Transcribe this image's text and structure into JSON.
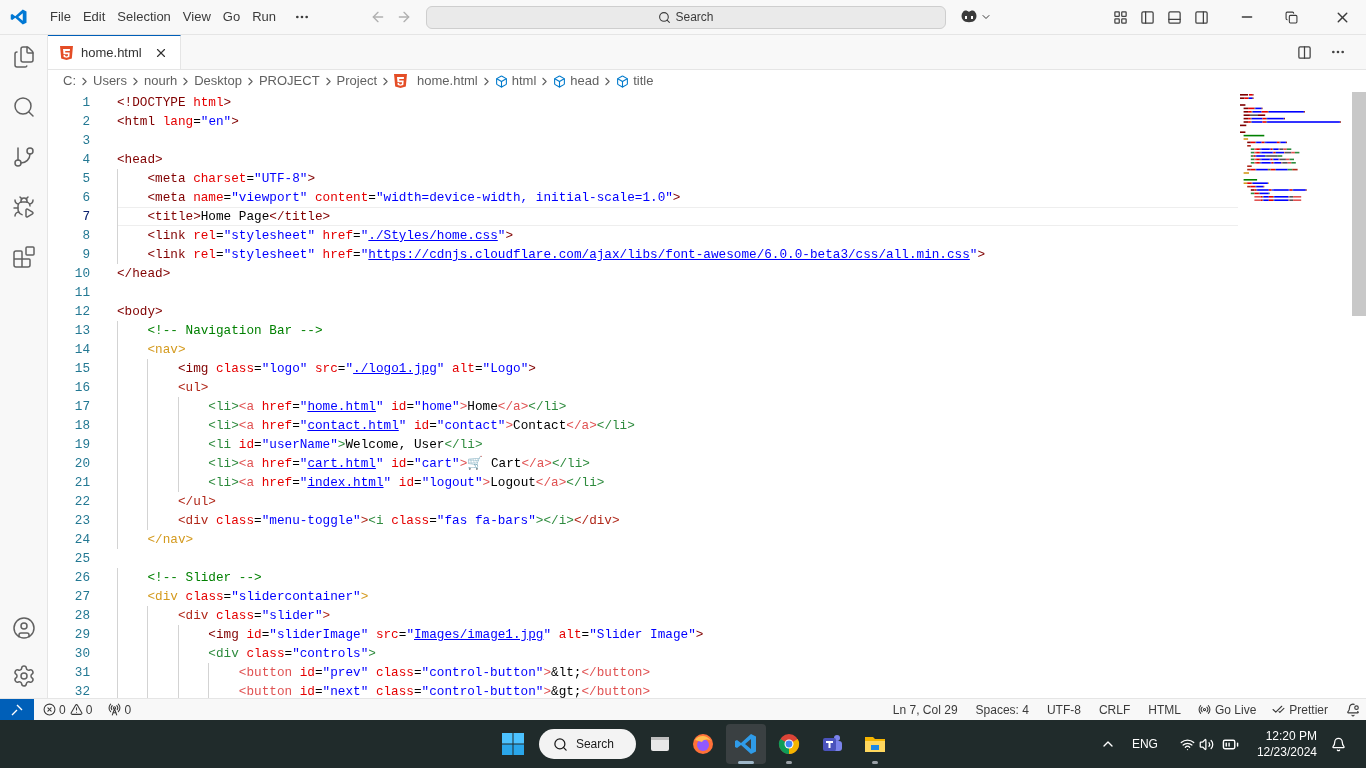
{
  "title_bar": {
    "menu": [
      "File",
      "Edit",
      "Selection",
      "View",
      "Go",
      "Run"
    ],
    "search": {
      "placeholder": "Search"
    }
  },
  "tab": {
    "label": "home.html",
    "selected": true
  },
  "breadcrumb": [
    {
      "label": "C:",
      "kind": "folder"
    },
    {
      "label": "Users",
      "kind": "folder"
    },
    {
      "label": "nourh",
      "kind": "folder"
    },
    {
      "label": "Desktop",
      "kind": "folder"
    },
    {
      "label": "PROJECT",
      "kind": "folder"
    },
    {
      "label": "Project",
      "kind": "folder"
    },
    {
      "label": "home.html",
      "kind": "file"
    },
    {
      "label": "html",
      "kind": "symbol"
    },
    {
      "label": "head",
      "kind": "symbol"
    },
    {
      "label": "title",
      "kind": "symbol"
    }
  ],
  "editor": {
    "lines": [
      {
        "number": "1",
        "current": false,
        "tokens": [
          {
            "text": "<!DOCTYPE ",
            "kind": "tag"
          },
          {
            "text": "html",
            "kind": "attr"
          },
          {
            "text": ">",
            "kind": "tag"
          }
        ]
      },
      {
        "number": "2",
        "current": false,
        "tokens": [
          {
            "text": "<html",
            "kind": "tag"
          },
          {
            "text": " lang",
            "kind": "attr"
          },
          {
            "text": "=",
            "kind": "punct"
          },
          {
            "text": "\"en\"",
            "kind": "str"
          },
          {
            "text": ">",
            "kind": "tag"
          }
        ]
      },
      {
        "number": "3",
        "current": false
      },
      {
        "number": "4",
        "current": false,
        "tokens": [
          {
            "text": "<head>",
            "kind": "tag"
          }
        ]
      },
      {
        "number": "5",
        "current": false,
        "tokens": [
          {
            "text": "    <meta",
            "kind": "tag"
          },
          {
            "text": " charset",
            "kind": "attr"
          },
          {
            "text": "=",
            "kind": "punct"
          },
          {
            "text": "\"UTF-8\"",
            "kind": "str"
          },
          {
            "text": ">",
            "kind": "tag"
          }
        ]
      },
      {
        "number": "6",
        "current": false,
        "tokens": [
          {
            "text": "    <meta",
            "kind": "tag"
          },
          {
            "text": " name",
            "kind": "attr"
          },
          {
            "text": "=",
            "kind": "punct"
          },
          {
            "text": "\"viewport\"",
            "kind": "str"
          },
          {
            "text": " content",
            "kind": "attr"
          },
          {
            "text": "=",
            "kind": "punct"
          },
          {
            "text": "\"width=device-width, initial-scale=1.0\"",
            "kind": "str"
          },
          {
            "text": ">",
            "kind": "tag"
          }
        ]
      },
      {
        "number": "7",
        "current": true,
        "tokens": [
          {
            "text": "    <title>",
            "kind": "tag"
          },
          {
            "text": "Home Page",
            "kind": "text"
          },
          {
            "text": "</title>",
            "kind": "tag"
          }
        ]
      },
      {
        "number": "8",
        "current": false,
        "tokens": [
          {
            "text": "    <link",
            "kind": "tag"
          },
          {
            "text": " rel",
            "kind": "attr"
          },
          {
            "text": "=",
            "kind": "punct"
          },
          {
            "text": "\"stylesheet\"",
            "kind": "str"
          },
          {
            "text": " href",
            "kind": "attr"
          },
          {
            "text": "=",
            "kind": "punct"
          },
          {
            "text": "\"",
            "kind": "str"
          },
          {
            "text": "./Styles/home.css",
            "kind": "link"
          },
          {
            "text": "\"",
            "kind": "str"
          },
          {
            "text": ">",
            "kind": "tag"
          }
        ]
      },
      {
        "number": "9",
        "current": false,
        "tokens": [
          {
            "text": "    <link",
            "kind": "tag"
          },
          {
            "text": " rel",
            "kind": "attr"
          },
          {
            "text": "=",
            "kind": "punct"
          },
          {
            "text": "\"stylesheet\"",
            "kind": "str"
          },
          {
            "text": " href",
            "kind": "attr"
          },
          {
            "text": "=",
            "kind": "punct"
          },
          {
            "text": "\"",
            "kind": "str"
          },
          {
            "text": "https://cdnjs.cloudflare.com/ajax/libs/font-awesome/6.0.0-beta3/css/all.min.css",
            "kind": "link"
          },
          {
            "text": "\"",
            "kind": "str"
          },
          {
            "text": ">",
            "kind": "tag"
          }
        ]
      },
      {
        "number": "10",
        "current": false,
        "tokens": [
          {
            "text": "</head>",
            "kind": "tag"
          }
        ]
      },
      {
        "number": "11",
        "current": false
      },
      {
        "number": "12",
        "current": false,
        "tokens": [
          {
            "text": "<body>",
            "kind": "tag"
          }
        ]
      },
      {
        "number": "13",
        "current": false,
        "tokens": [
          {
            "text": "    <!-- Navigation Bar -->",
            "kind": "comment"
          }
        ]
      },
      {
        "number": "14",
        "current": false,
        "tokens": [
          {
            "text": "    <nav>",
            "kind": "tag_outer"
          }
        ]
      },
      {
        "number": "15",
        "current": false,
        "tokens": [
          {
            "text": "        <img",
            "kind": "tag"
          },
          {
            "text": " class",
            "kind": "attr"
          },
          {
            "text": "=",
            "kind": "punct"
          },
          {
            "text": "\"logo\"",
            "kind": "str"
          },
          {
            "text": " src",
            "kind": "attr"
          },
          {
            "text": "=",
            "kind": "punct"
          },
          {
            "text": "\"",
            "kind": "str"
          },
          {
            "text": "./logo1.jpg",
            "kind": "link"
          },
          {
            "text": "\"",
            "kind": "str"
          },
          {
            "text": " alt",
            "kind": "attr"
          },
          {
            "text": "=",
            "kind": "punct"
          },
          {
            "text": "\"Logo\"",
            "kind": "str"
          },
          {
            "text": ">",
            "kind": "tag"
          }
        ]
      },
      {
        "number": "16",
        "current": false,
        "tokens": [
          {
            "text": "        <ul>",
            "kind": "tag_mid"
          }
        ]
      },
      {
        "number": "17",
        "current": false,
        "tokens": [
          {
            "text": "            <li>",
            "kind": "tag_inner"
          },
          {
            "text": "<a",
            "kind": "tag_deep"
          },
          {
            "text": " href",
            "kind": "attr"
          },
          {
            "text": "=",
            "kind": "punct"
          },
          {
            "text": "\"",
            "kind": "str"
          },
          {
            "text": "home.html",
            "kind": "link"
          },
          {
            "text": "\"",
            "kind": "str"
          },
          {
            "text": " id",
            "kind": "attr"
          },
          {
            "text": "=",
            "kind": "punct"
          },
          {
            "text": "\"home\"",
            "kind": "str"
          },
          {
            "text": ">",
            "kind": "tag_deep"
          },
          {
            "text": "Home",
            "kind": "text"
          },
          {
            "text": "</a>",
            "kind": "tag_deep"
          },
          {
            "text": "</li>",
            "kind": "tag_inner"
          }
        ]
      },
      {
        "number": "18",
        "current": false,
        "tokens": [
          {
            "text": "            <li>",
            "kind": "tag_inner"
          },
          {
            "text": "<a",
            "kind": "tag_deep"
          },
          {
            "text": " href",
            "kind": "attr"
          },
          {
            "text": "=",
            "kind": "punct"
          },
          {
            "text": "\"",
            "kind": "str"
          },
          {
            "text": "contact.html",
            "kind": "link"
          },
          {
            "text": "\"",
            "kind": "str"
          },
          {
            "text": " id",
            "kind": "attr"
          },
          {
            "text": "=",
            "kind": "punct"
          },
          {
            "text": "\"contact\"",
            "kind": "str"
          },
          {
            "text": ">",
            "kind": "tag_deep"
          },
          {
            "text": "Contact",
            "kind": "text"
          },
          {
            "text": "</a>",
            "kind": "tag_deep"
          },
          {
            "text": "</li>",
            "kind": "tag_inner"
          }
        ]
      },
      {
        "number": "19",
        "current": false,
        "tokens": [
          {
            "text": "            <li",
            "kind": "tag_inner"
          },
          {
            "text": " id",
            "kind": "attr"
          },
          {
            "text": "=",
            "kind": "punct"
          },
          {
            "text": "\"userName\"",
            "kind": "str"
          },
          {
            "text": ">",
            "kind": "tag_inner"
          },
          {
            "text": "Welcome, User",
            "kind": "text"
          },
          {
            "text": "</li>",
            "kind": "tag_inner"
          }
        ]
      },
      {
        "number": "20",
        "current": false,
        "tokens": [
          {
            "text": "            <li>",
            "kind": "tag_inner"
          },
          {
            "text": "<a",
            "kind": "tag_deep"
          },
          {
            "text": " href",
            "kind": "attr"
          },
          {
            "text": "=",
            "kind": "punct"
          },
          {
            "text": "\"",
            "kind": "str"
          },
          {
            "text": "cart.html",
            "kind": "link"
          },
          {
            "text": "\"",
            "kind": "str"
          },
          {
            "text": " id",
            "kind": "attr"
          },
          {
            "text": "=",
            "kind": "punct"
          },
          {
            "text": "\"cart\"",
            "kind": "str"
          },
          {
            "text": ">",
            "kind": "tag_deep"
          },
          {
            "text": "🛒 Cart",
            "kind": "text"
          },
          {
            "text": "</a>",
            "kind": "tag_deep"
          },
          {
            "text": "</li>",
            "kind": "tag_inner"
          }
        ]
      },
      {
        "number": "21",
        "current": false,
        "tokens": [
          {
            "text": "            <li>",
            "kind": "tag_inner"
          },
          {
            "text": "<a",
            "kind": "tag_deep"
          },
          {
            "text": " href",
            "kind": "attr"
          },
          {
            "text": "=",
            "kind": "punct"
          },
          {
            "text": "\"",
            "kind": "str"
          },
          {
            "text": "index.html",
            "kind": "link"
          },
          {
            "text": "\"",
            "kind": "str"
          },
          {
            "text": " id",
            "kind": "attr"
          },
          {
            "text": "=",
            "kind": "punct"
          },
          {
            "text": "\"logout\"",
            "kind": "str"
          },
          {
            "text": ">",
            "kind": "tag_deep"
          },
          {
            "text": "Logout",
            "kind": "text"
          },
          {
            "text": "</a>",
            "kind": "tag_deep"
          },
          {
            "text": "</li>",
            "kind": "tag_inner"
          }
        ]
      },
      {
        "number": "22",
        "current": false,
        "tokens": [
          {
            "text": "        </ul>",
            "kind": "tag_mid"
          }
        ]
      },
      {
        "number": "23",
        "current": false,
        "tokens": [
          {
            "text": "        <div",
            "kind": "tag_mid"
          },
          {
            "text": " class",
            "kind": "attr"
          },
          {
            "text": "=",
            "kind": "punct"
          },
          {
            "text": "\"menu-toggle\"",
            "kind": "str"
          },
          {
            "text": ">",
            "kind": "tag_mid"
          },
          {
            "text": "<i",
            "kind": "tag_inner"
          },
          {
            "text": " class",
            "kind": "attr"
          },
          {
            "text": "=",
            "kind": "punct"
          },
          {
            "text": "\"fas fa-bars\"",
            "kind": "str"
          },
          {
            "text": "></i>",
            "kind": "tag_inner"
          },
          {
            "text": "</div>",
            "kind": "tag_mid"
          }
        ]
      },
      {
        "number": "24",
        "current": false,
        "tokens": [
          {
            "text": "    </nav>",
            "kind": "tag_outer"
          }
        ]
      },
      {
        "number": "25",
        "current": false
      },
      {
        "number": "26",
        "current": false,
        "tokens": [
          {
            "text": "    <!-- Slider -->",
            "kind": "comment"
          }
        ]
      },
      {
        "number": "27",
        "current": false,
        "tokens": [
          {
            "text": "    <div",
            "kind": "tag_outer"
          },
          {
            "text": " class",
            "kind": "attr"
          },
          {
            "text": "=",
            "kind": "punct"
          },
          {
            "text": "\"slidercontainer\"",
            "kind": "str"
          },
          {
            "text": ">",
            "kind": "tag_outer"
          }
        ]
      },
      {
        "number": "28",
        "current": false,
        "tokens": [
          {
            "text": "        <div",
            "kind": "tag_mid"
          },
          {
            "text": " class",
            "kind": "attr"
          },
          {
            "text": "=",
            "kind": "punct"
          },
          {
            "text": "\"slider\"",
            "kind": "str"
          },
          {
            "text": ">",
            "kind": "tag_mid"
          }
        ]
      },
      {
        "number": "29",
        "current": false,
        "tokens": [
          {
            "text": "            <img",
            "kind": "tag"
          },
          {
            "text": " id",
            "kind": "attr"
          },
          {
            "text": "=",
            "kind": "punct"
          },
          {
            "text": "\"sliderImage\"",
            "kind": "str"
          },
          {
            "text": " src",
            "kind": "attr"
          },
          {
            "text": "=",
            "kind": "punct"
          },
          {
            "text": "\"",
            "kind": "str"
          },
          {
            "text": "Images/image1.jpg",
            "kind": "link"
          },
          {
            "text": "\"",
            "kind": "str"
          },
          {
            "text": " alt",
            "kind": "attr"
          },
          {
            "text": "=",
            "kind": "punct"
          },
          {
            "text": "\"Slider Image\"",
            "kind": "str"
          },
          {
            "text": ">",
            "kind": "tag"
          }
        ]
      },
      {
        "number": "30",
        "current": false,
        "tokens": [
          {
            "text": "            <div",
            "kind": "tag_inner"
          },
          {
            "text": " class",
            "kind": "attr"
          },
          {
            "text": "=",
            "kind": "punct"
          },
          {
            "text": "\"controls\"",
            "kind": "str"
          },
          {
            "text": ">",
            "kind": "tag_inner"
          }
        ]
      },
      {
        "number": "31",
        "current": false,
        "tokens": [
          {
            "text": "                <button",
            "kind": "tag_deep"
          },
          {
            "text": " id",
            "kind": "attr"
          },
          {
            "text": "=",
            "kind": "punct"
          },
          {
            "text": "\"prev\"",
            "kind": "str"
          },
          {
            "text": " class",
            "kind": "attr"
          },
          {
            "text": "=",
            "kind": "punct"
          },
          {
            "text": "\"control-button\"",
            "kind": "str"
          },
          {
            "text": ">",
            "kind": "tag_deep"
          },
          {
            "text": "&lt;",
            "kind": "text"
          },
          {
            "text": "</button>",
            "kind": "tag_deep"
          }
        ]
      },
      {
        "number": "32",
        "current": false,
        "tokens": [
          {
            "text": "                <button",
            "kind": "tag_deep"
          },
          {
            "text": " id",
            "kind": "attr"
          },
          {
            "text": "=",
            "kind": "punct"
          },
          {
            "text": "\"next\"",
            "kind": "str"
          },
          {
            "text": " class",
            "kind": "attr"
          },
          {
            "text": "=",
            "kind": "punct"
          },
          {
            "text": "\"control-button\"",
            "kind": "str"
          },
          {
            "text": ">",
            "kind": "tag_deep"
          },
          {
            "text": "&gt;",
            "kind": "text"
          },
          {
            "text": "</button>",
            "kind": "tag_deep"
          }
        ]
      }
    ]
  },
  "status_bar": {
    "errors": "0",
    "warnings": "0",
    "ports": "0",
    "items": [
      "Ln 7, Col 29",
      "Spaces: 4",
      "UTF-8",
      "CRLF",
      "HTML"
    ],
    "go_live": "Go Live",
    "prettier": "Prettier"
  },
  "taskbar": {
    "search": "Search",
    "apps": [
      {
        "kind": "window",
        "running": false,
        "focused": false
      },
      {
        "kind": "firefox",
        "running": false,
        "focused": false
      },
      {
        "kind": "vscode",
        "running": true,
        "focused": true
      },
      {
        "kind": "chrome",
        "running": true,
        "focused": false
      },
      {
        "kind": "teams",
        "running": false,
        "focused": false
      },
      {
        "kind": "explorer",
        "running": true,
        "focused": false
      }
    ],
    "language": "ENG",
    "time": "12:20 PM",
    "date": "12/23/2024"
  }
}
